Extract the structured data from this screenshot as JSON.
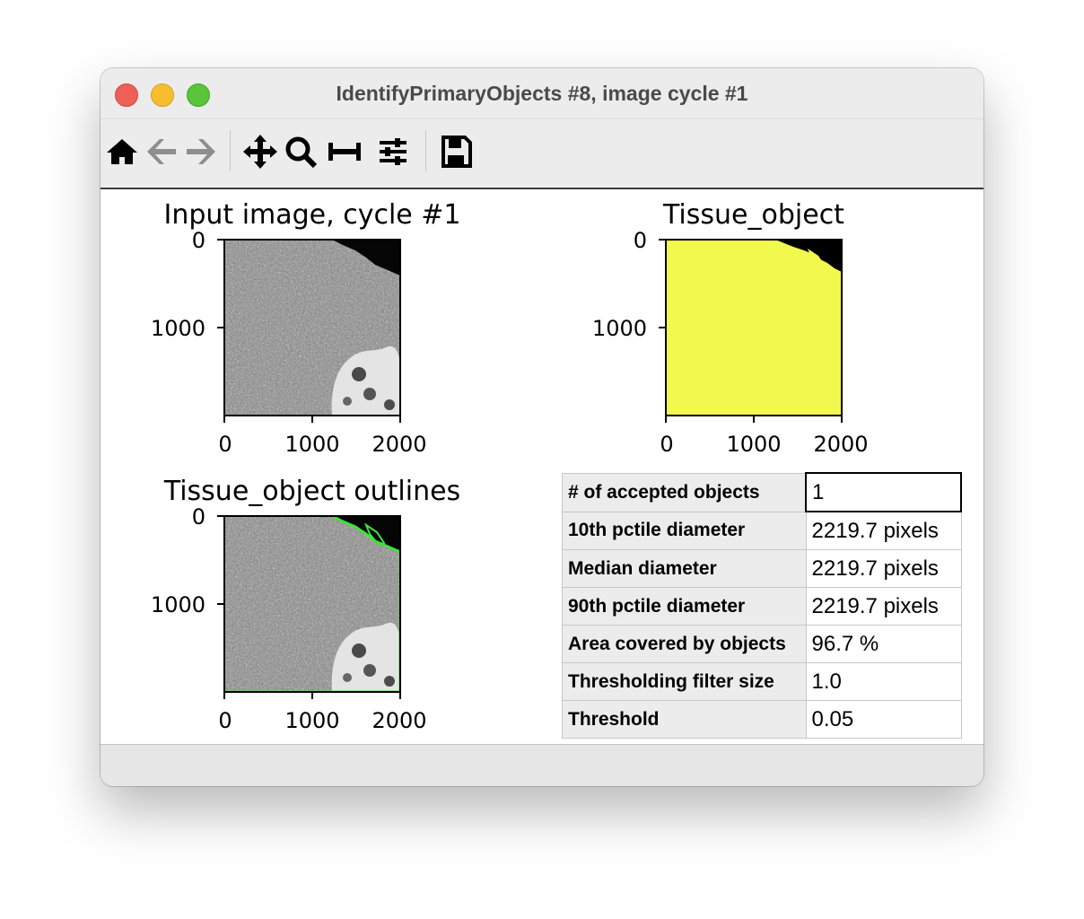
{
  "window": {
    "title": "IdentifyPrimaryObjects #8, image cycle #1"
  },
  "toolbar": {
    "buttons": [
      {
        "name": "home",
        "icon": "home-icon"
      },
      {
        "name": "back",
        "icon": "arrow-left-icon"
      },
      {
        "name": "forward",
        "icon": "arrow-right-icon"
      },
      {
        "name": "pan",
        "icon": "move-icon"
      },
      {
        "name": "zoom",
        "icon": "zoom-icon"
      },
      {
        "name": "subplots",
        "icon": "subplots-icon"
      },
      {
        "name": "configure",
        "icon": "sliders-icon"
      },
      {
        "name": "save",
        "icon": "save-icon"
      }
    ]
  },
  "panels": {
    "input": {
      "title": "Input image, cycle #1",
      "y_ticks": [
        "0",
        "1000"
      ],
      "x_ticks": [
        "0",
        "1000",
        "2000"
      ]
    },
    "tissue": {
      "title": "Tissue_object",
      "y_ticks": [
        "0",
        "1000"
      ],
      "x_ticks": [
        "0",
        "1000",
        "2000"
      ],
      "fill_color": "#f1f94f"
    },
    "outlines": {
      "title": "Tissue_object outlines",
      "y_ticks": [
        "0",
        "1000"
      ],
      "x_ticks": [
        "0",
        "1000",
        "2000"
      ],
      "outline_color": "#3fe03f"
    }
  },
  "stats": [
    {
      "label": "# of accepted objects",
      "value": "1"
    },
    {
      "label": "10th pctile diameter",
      "value": "2219.7 pixels"
    },
    {
      "label": "Median diameter",
      "value": "2219.7 pixels"
    },
    {
      "label": "90th pctile diameter",
      "value": "2219.7 pixels"
    },
    {
      "label": "Area covered by objects",
      "value": "96.7 %"
    },
    {
      "label": "Thresholding filter size",
      "value": "1.0"
    },
    {
      "label": "Threshold",
      "value": "0.05"
    }
  ]
}
